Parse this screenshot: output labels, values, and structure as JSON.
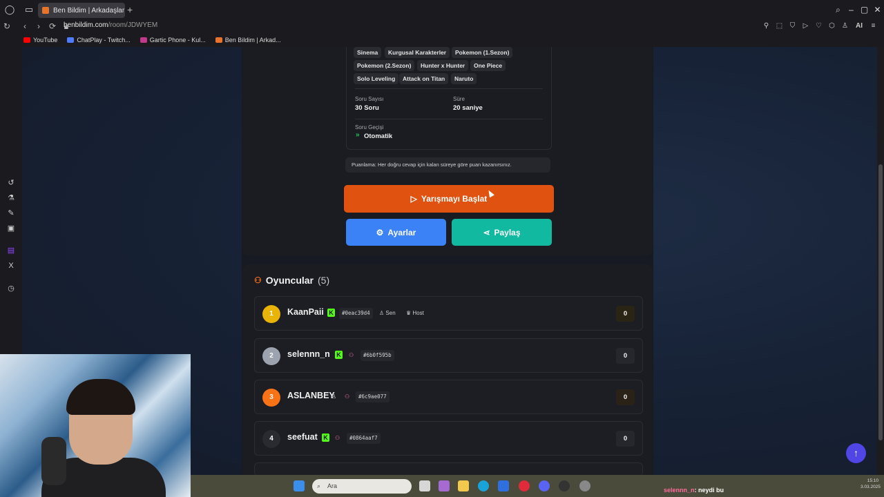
{
  "browser": {
    "tab_title": "Ben Bildim | Arkadaşlarını",
    "url_domain": "benbildim.com",
    "url_path": "/room/JDWYEM",
    "bookmarks": [
      {
        "label": "YouTube",
        "color": "#ff0000"
      },
      {
        "label": "ChatPlay - Twitch...",
        "color": "#4f7cff"
      },
      {
        "label": "Gartic Phone - Kul...",
        "color": "#c0398b"
      },
      {
        "label": "Ben Bildim | Arkad...",
        "color": "#e8742c"
      }
    ],
    "ai_label": "AI"
  },
  "room": {
    "categories": [
      "Sinema",
      "Kurgusal Karakterler",
      "Pokemon (1.Sezon)",
      "Pokemon (2.Sezon)",
      "Hunter x Hunter",
      "One Piece",
      "Solo Leveling",
      "Attack on Titan",
      "Naruto"
    ],
    "question_count_label": "Soru Sayısı",
    "question_count_value": "30 Soru",
    "duration_label": "Süre",
    "duration_value": "20 saniye",
    "transition_label": "Soru Geçişi",
    "transition_value": "Otomatik",
    "scoring_note": "Puanlama: Her doğru cevap için kalan süreye göre puan kazanırsınız.",
    "start_button": "Yarışmayı Başlat",
    "settings_button": "Ayarlar",
    "share_button": "Paylaş",
    "accent": "#e0520f",
    "settings_color": "#3b82f6",
    "share_color": "#10b9a0"
  },
  "players": {
    "title": "Oyuncular",
    "count": "(5)",
    "list": [
      {
        "rank": "1",
        "name": "KaanPaii",
        "hash": "#0eac39d4",
        "you": "Sen",
        "host": "Host",
        "score": "0",
        "rank_color": "#eab308"
      },
      {
        "rank": "2",
        "name": "selennn_n",
        "hash": "#6b0f595b",
        "score": "0",
        "rank_color": "#9ca3af"
      },
      {
        "rank": "3",
        "name": "ASLANBEY",
        "hash": "#6c9ae077",
        "score": "0",
        "rank_color": "#f97316"
      },
      {
        "rank": "4",
        "name": "seefuat",
        "hash": "#0864aaf7",
        "score": "0",
        "rank_color": "#2a2b31"
      }
    ]
  },
  "taskbar": {
    "search_placeholder": "Ara",
    "chat_user": "selennn_n",
    "chat_message": ": neydi bu",
    "time": "15:10",
    "date": "3.03.2025"
  }
}
